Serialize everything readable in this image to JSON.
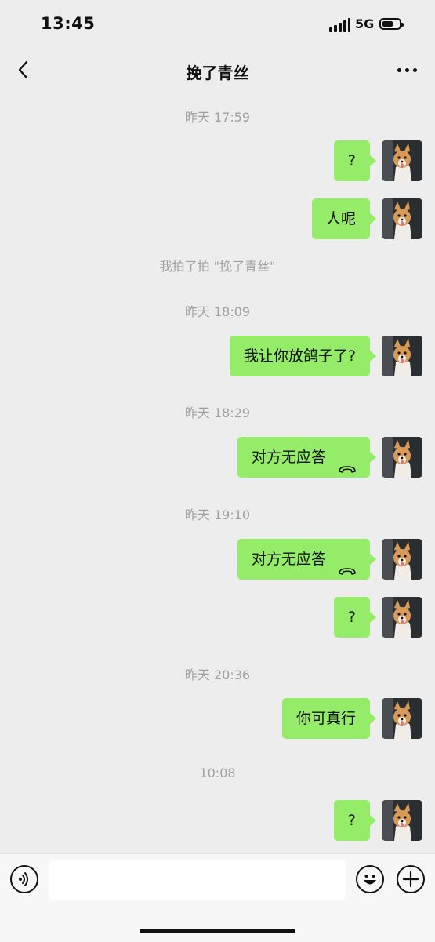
{
  "status_bar": {
    "time": "13:45",
    "network": "5G"
  },
  "nav": {
    "title": "挽了青丝"
  },
  "messages": {
    "ts1": "昨天 17:59",
    "m1": "?",
    "m2": "人呢",
    "sys1": "我拍了拍 \"挽了青丝\"",
    "ts2": "昨天 18:09",
    "m3": "我让你放鸽子了?",
    "ts3": "昨天 18:29",
    "call1": "对方无应答",
    "ts4": "昨天 19:10",
    "call2": "对方无应答",
    "m4": "?",
    "ts5": "昨天 20:36",
    "m5": "你可真行",
    "ts6": "10:08",
    "m6": "?"
  },
  "colors": {
    "bubble": "#95ec69",
    "background": "#ededed",
    "timestamp": "#a0a0a0"
  },
  "icons": [
    "back-arrow-icon",
    "more-dots-icon",
    "phone-hangup-icon",
    "voice-icon",
    "emoji-icon",
    "plus-icon"
  ]
}
